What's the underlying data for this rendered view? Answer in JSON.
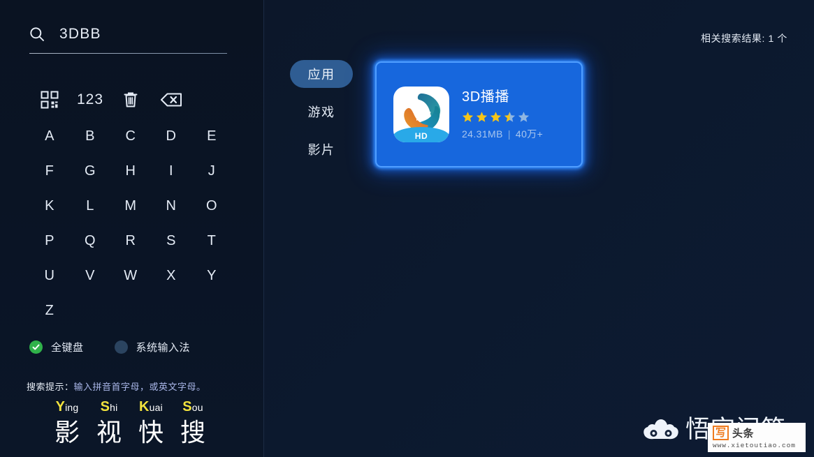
{
  "search": {
    "icon": "search-icon",
    "value": "3DBB",
    "placeholder": ""
  },
  "keyboard": {
    "function_keys": [
      {
        "name": "qr-keyboard-icon",
        "label": ""
      },
      {
        "name": "numeric-key",
        "label": "123"
      },
      {
        "name": "trash-icon",
        "label": ""
      },
      {
        "name": "backspace-icon",
        "label": ""
      }
    ],
    "letters": [
      [
        "A",
        "B",
        "C",
        "D",
        "E"
      ],
      [
        "F",
        "G",
        "H",
        "I",
        "J"
      ],
      [
        "K",
        "L",
        "M",
        "N",
        "O"
      ],
      [
        "P",
        "Q",
        "R",
        "S",
        "T"
      ],
      [
        "U",
        "V",
        "W",
        "X",
        "Y"
      ],
      [
        "Z",
        "",
        "",
        "",
        ""
      ]
    ],
    "modes": [
      {
        "label": "全键盘",
        "selected": true
      },
      {
        "label": "系统输入法",
        "selected": false
      }
    ]
  },
  "hint": {
    "label": "搜索提示：",
    "body": "输入拼音首字母，或英文字母。"
  },
  "brand": {
    "pinyin": [
      {
        "cap": "Y",
        "rest": "ing"
      },
      {
        "cap": "S",
        "rest": "hi"
      },
      {
        "cap": "K",
        "rest": "uai"
      },
      {
        "cap": "S",
        "rest": "ou"
      }
    ],
    "characters": [
      "影",
      "视",
      "快",
      "搜"
    ]
  },
  "results": {
    "count_text": "相关搜索结果: 1 个",
    "tabs": [
      {
        "label": "应用",
        "active": true
      },
      {
        "label": "游戏",
        "active": false
      },
      {
        "label": "影片",
        "active": false
      }
    ],
    "app": {
      "name": "3D播播",
      "rating": 3.5,
      "rating_max": 5,
      "size": "24.31MB",
      "separator": "|",
      "downloads": "40万+",
      "badge": "HD"
    }
  },
  "watermark": {
    "site_name": "悟空问答",
    "overlay_mark": "写",
    "overlay_text": "头条",
    "overlay_url": "www.xietoutiao.com"
  },
  "colors": {
    "accent_blue": "#1767dd",
    "glow_blue": "#4f9dff",
    "tab_active": "#2f5d93",
    "star_on": "#f5c518",
    "star_off": "#8fb6e2",
    "radio_on": "#30b24a",
    "radio_off": "#2b4460",
    "brand_yellow": "#f2e33d",
    "hint_body": "#a9b6e8"
  }
}
